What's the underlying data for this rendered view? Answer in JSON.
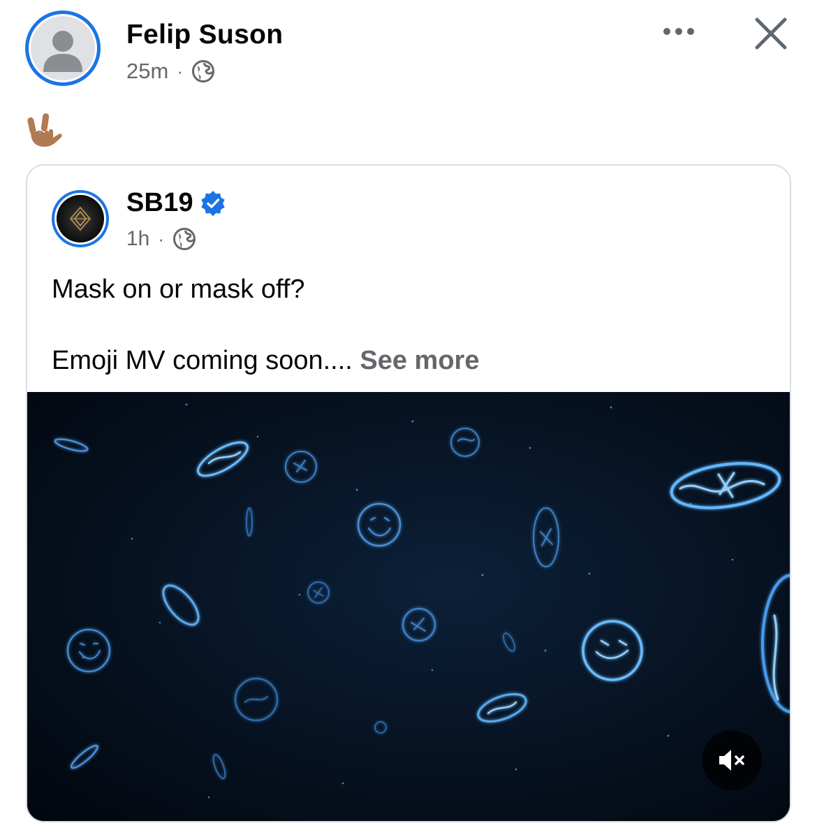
{
  "author": {
    "name": "Felip Suson",
    "time": "25m",
    "separator": "·",
    "privacy_icon": "globe-icon"
  },
  "post": {
    "emoji": "🤟🏽",
    "emoji_icon": "love-you-gesture-medium-skin-tone"
  },
  "header_actions": {
    "more_icon": "more-horizontal-icon",
    "close_icon": "close-icon"
  },
  "shared_post": {
    "page_name": "SB19",
    "verified_icon": "verified-badge-icon",
    "time": "1h",
    "separator": "·",
    "privacy_icon": "globe-icon",
    "text_line1": "Mask on or mask off?",
    "text_line2": "Emoji MV coming soon....",
    "see_more": "See more",
    "video": {
      "mute_icon": "speaker-muted-icon"
    }
  },
  "colors": {
    "accent": "#1b74e4",
    "secondary_text": "#65676b",
    "video_bg": "#040d1b",
    "glow": "#5fb3ff"
  }
}
